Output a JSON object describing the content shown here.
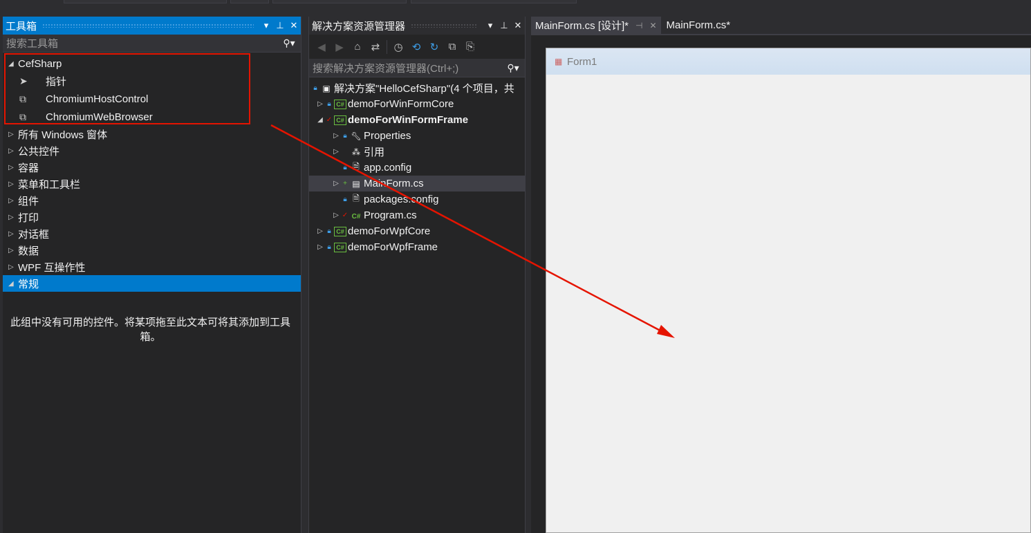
{
  "toolbox": {
    "title": "工具箱",
    "search_placeholder": "搜索工具箱",
    "groups": [
      {
        "label": "CefSharp",
        "expanded": true
      },
      {
        "label": "所有 Windows 窗体"
      },
      {
        "label": "公共控件"
      },
      {
        "label": "容器"
      },
      {
        "label": "菜单和工具栏"
      },
      {
        "label": "组件"
      },
      {
        "label": "打印"
      },
      {
        "label": "对话框"
      },
      {
        "label": "数据"
      },
      {
        "label": "WPF 互操作性"
      },
      {
        "label": "常规",
        "expanded": true,
        "selected": true
      }
    ],
    "cefsharp_items": [
      {
        "label": "指针",
        "icon": "pointer-icon"
      },
      {
        "label": "ChromiumHostControl",
        "icon": "component-icon"
      },
      {
        "label": "ChromiumWebBrowser",
        "icon": "component-icon"
      }
    ],
    "empty_message": "此组中没有可用的控件。将某项拖至此文本可将其添加到工具箱。"
  },
  "solution_explorer": {
    "title": "解决方案资源管理器",
    "search_placeholder": "搜索解决方案资源管理器(Ctrl+;)",
    "tree": [
      {
        "label": "解决方案\"HelloCefSharp\"(4 个项目，共",
        "level": 0
      },
      {
        "label": "demoForWinFormCore",
        "level": 1
      },
      {
        "label": "demoForWinFormFrame",
        "level": 1
      },
      {
        "label": "Properties",
        "level": 2
      },
      {
        "label": "引用",
        "level": 2
      },
      {
        "label": "app.config",
        "level": 2
      },
      {
        "label": "MainForm.cs",
        "level": 2
      },
      {
        "label": "packages.config",
        "level": 2
      },
      {
        "label": "Program.cs",
        "level": 2
      },
      {
        "label": "demoForWpfCore",
        "level": 1
      },
      {
        "label": "demoForWpfFrame",
        "level": 1
      }
    ]
  },
  "documents": {
    "tabs": [
      {
        "label": "MainForm.cs [设计]*",
        "active": true
      },
      {
        "label": "MainForm.cs*",
        "active": false
      }
    ],
    "form_title": "Form1"
  },
  "colors": {
    "accent": "#007acc",
    "highlight": "#e51400"
  }
}
